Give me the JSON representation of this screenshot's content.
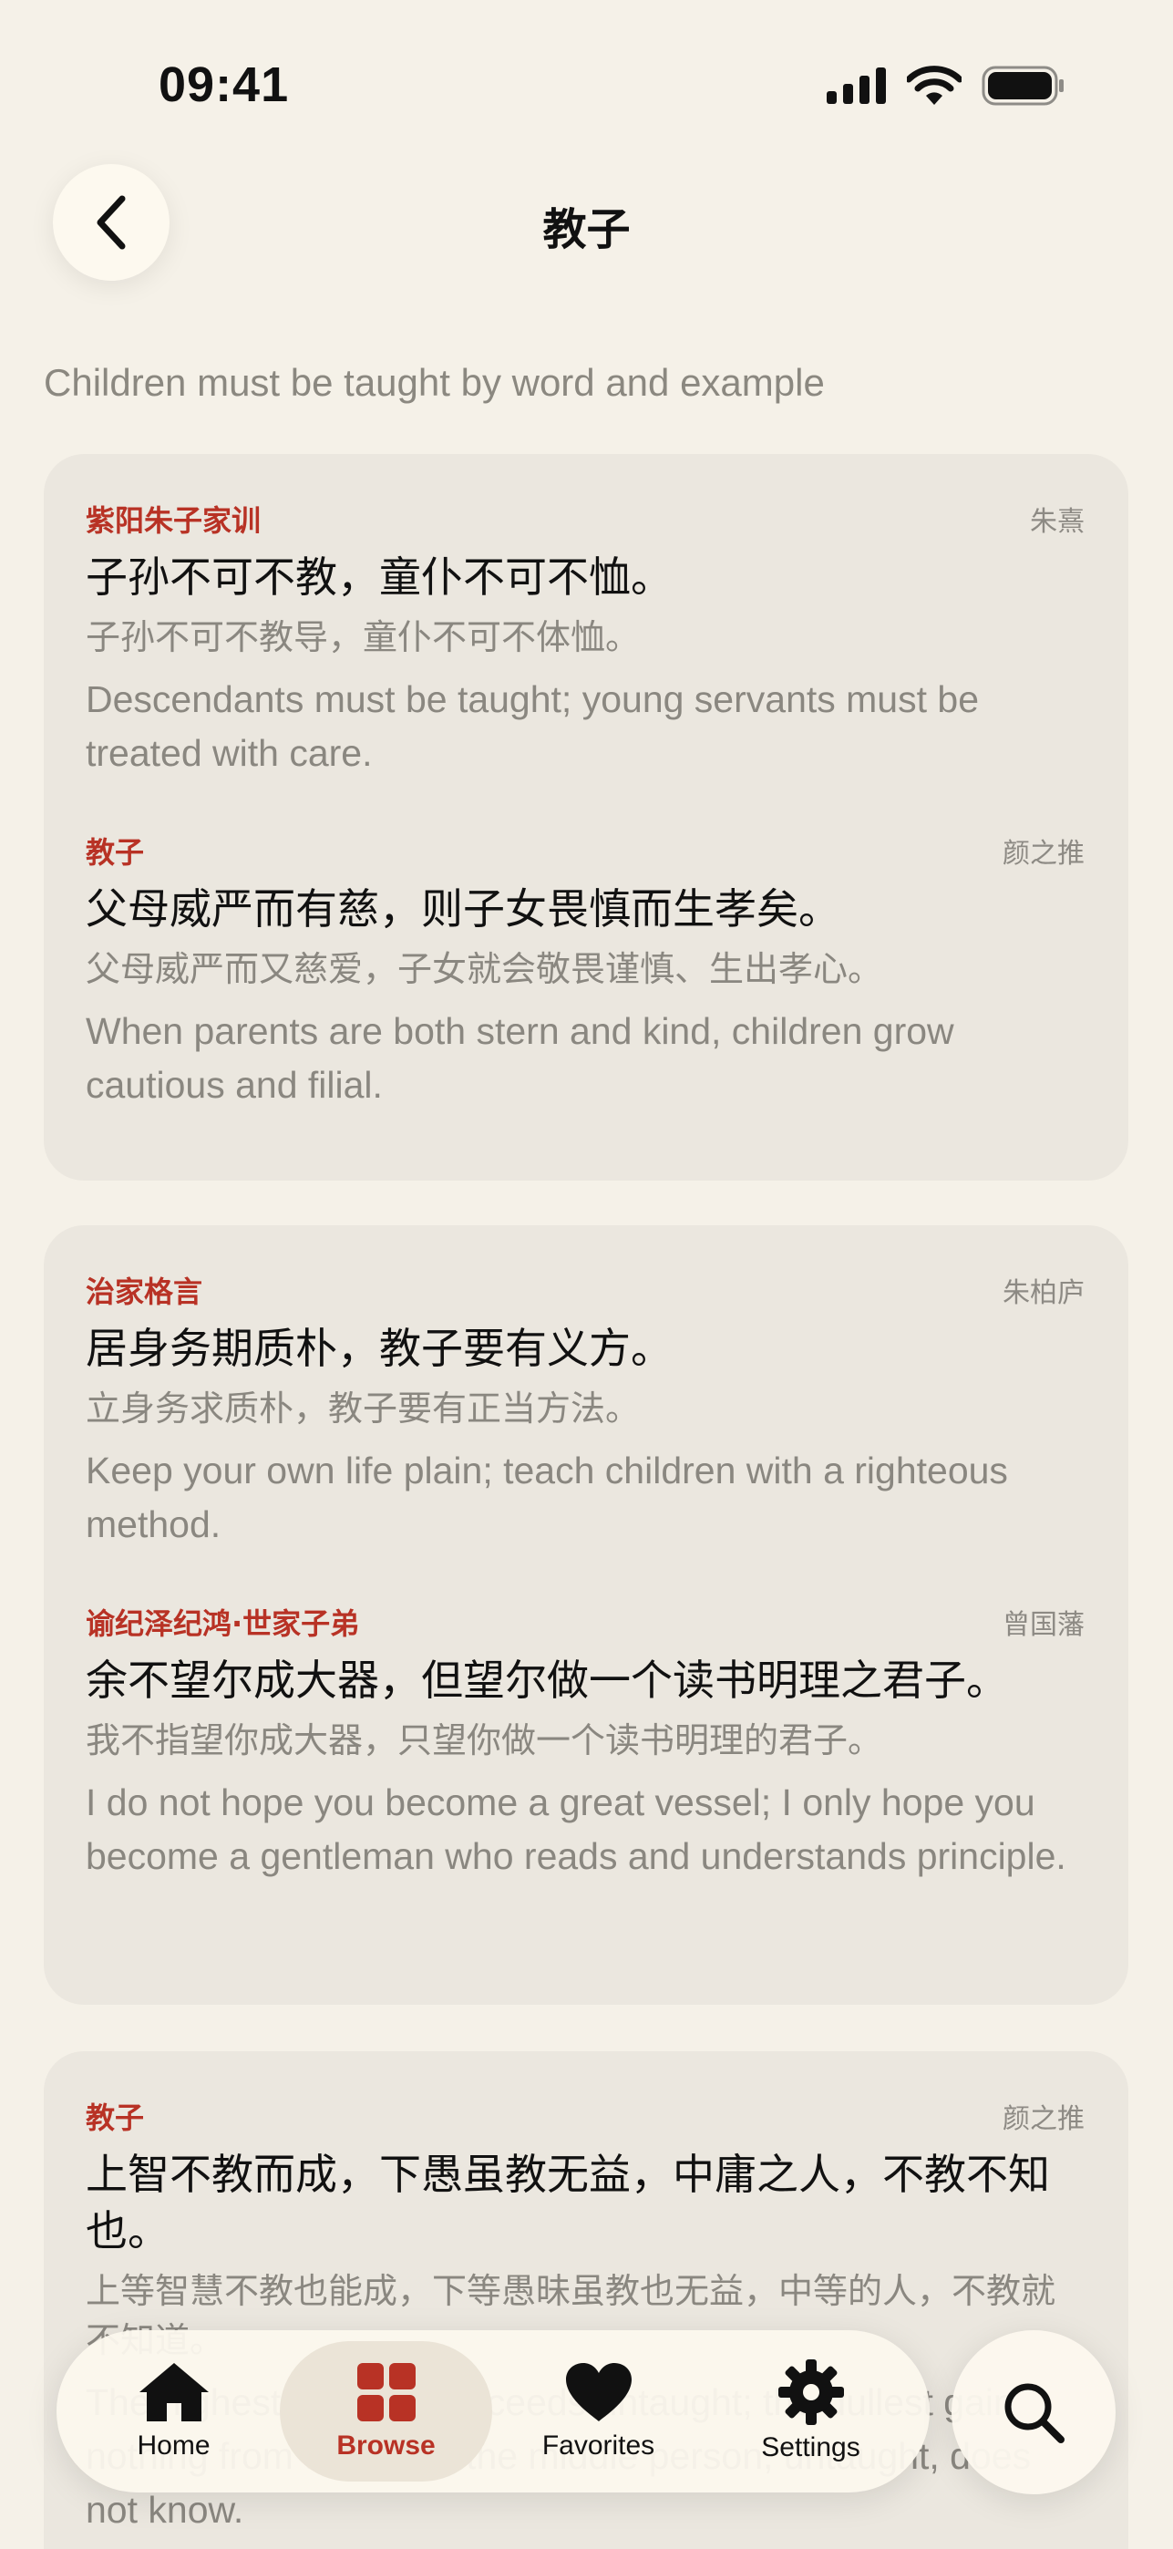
{
  "status_bar": {
    "time": "09:41"
  },
  "nav": {
    "title": "教子"
  },
  "subtitle": "Children must be taught by word and example",
  "cards": [
    {
      "entries": [
        {
          "source": "紫阳朱子家训",
          "author": "朱熹",
          "original": "子孙不可不教，童仆不可不恤。",
          "modern": "子孙不可不教导，童仆不可不体恤。",
          "english": "Descendants must be taught; young servants must be treated with care."
        },
        {
          "source": "教子",
          "author": "颜之推",
          "original": "父母威严而有慈，则子女畏慎而生孝矣。",
          "modern": "父母威严而又慈爱，子女就会敬畏谨慎、生出孝心。",
          "english": "When parents are both stern and kind, children grow cautious and filial."
        }
      ]
    },
    {
      "entries": [
        {
          "source": "治家格言",
          "author": "朱柏庐",
          "original": "居身务期质朴，教子要有义方。",
          "modern": "立身务求质朴，教子要有正当方法。",
          "english": "Keep your own life plain; teach children with a righteous method."
        },
        {
          "source": "谕纪泽纪鸿·世家子弟",
          "author": "曾国藩",
          "original": "余不望尔成大器，但望尔做一个读书明理之君子。",
          "modern": "我不指望你成大器，只望你做一个读书明理的君子。",
          "english": "I do not hope you become a great vessel; I only hope you become a gentleman who reads and understands principle."
        }
      ]
    },
    {
      "entries": [
        {
          "source": "教子",
          "author": "颜之推",
          "original": "上智不教而成，下愚虽教无益，中庸之人，不教不知也。",
          "modern": "上等智慧不教也能成，下等愚昧虽教也无益，中等的人，不教就不知道。",
          "english": "The highest wisdom succeeds untaught; the dullest gain nothing from teaching; the middle person, untaught, does not know."
        }
      ]
    }
  ],
  "tab_bar": {
    "tabs": [
      {
        "label": "Home",
        "icon": "home-icon",
        "active": false
      },
      {
        "label": "Browse",
        "icon": "grid-icon",
        "active": true
      },
      {
        "label": "Favorites",
        "icon": "heart-icon",
        "active": false
      },
      {
        "label": "Settings",
        "icon": "gear-icon",
        "active": false
      }
    ]
  },
  "colors": {
    "accent": "#b83225",
    "background": "#f5f1e8",
    "card": "#ebe7df",
    "muted_text": "#8a8780"
  }
}
